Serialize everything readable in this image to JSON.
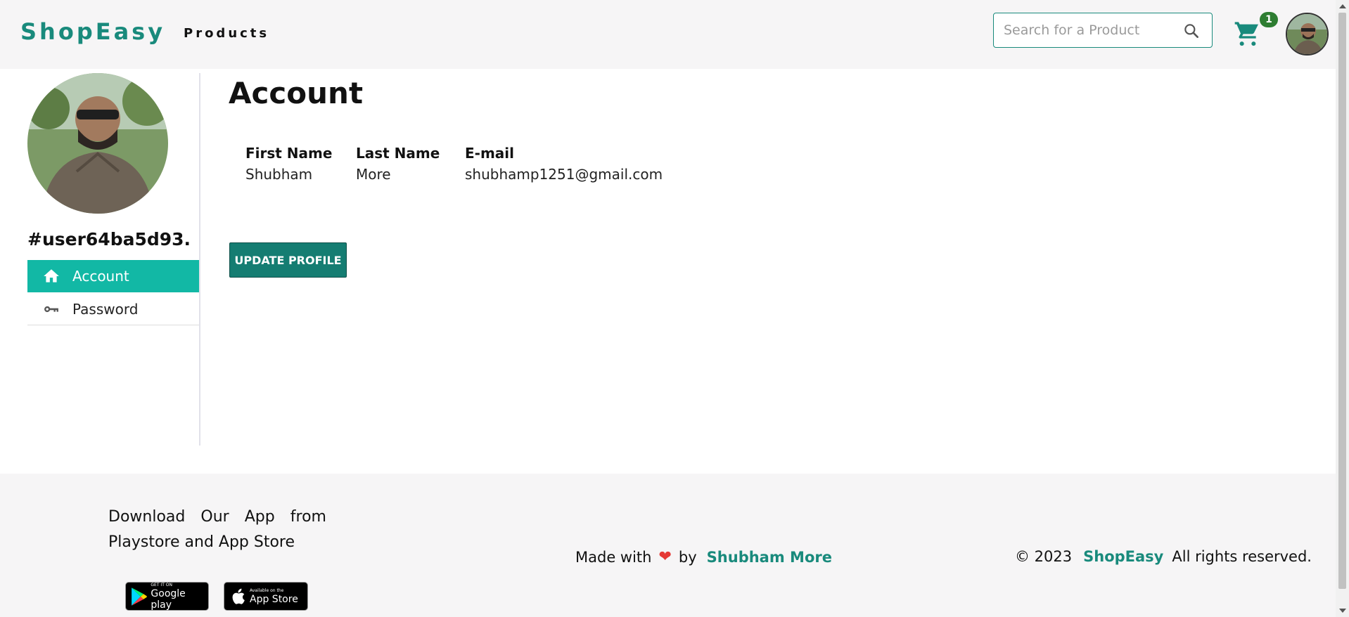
{
  "header": {
    "brand": "ShopEasy",
    "nav_products": "Products",
    "search_placeholder": "Search for a Product",
    "cart_count": "1"
  },
  "sidebar": {
    "username": "#user64ba5d93...",
    "items": [
      {
        "label": "Account",
        "icon": "home-icon",
        "active": true
      },
      {
        "label": "Password",
        "icon": "key-icon",
        "active": false
      }
    ]
  },
  "main": {
    "title": "Account",
    "fields": [
      {
        "label": "First Name",
        "value": "Shubham"
      },
      {
        "label": "Last Name",
        "value": "More"
      },
      {
        "label": "E-mail",
        "value": "shubhamp1251@gmail.com"
      }
    ],
    "update_button": "UPDATE PROFILE"
  },
  "footer": {
    "download_text": "Download Our App from Playstore and App Store",
    "google_play": {
      "small": "GET IT ON",
      "big": "Google play"
    },
    "app_store": {
      "small": "Available on the",
      "big": "App Store"
    },
    "made_with": "Made with",
    "by": "by",
    "author": "Shubham More",
    "copyright_year": "© 2023",
    "copyright_brand": "ShopEasy",
    "rights": "All rights reserved."
  },
  "colors": {
    "accent": "#198a7c",
    "active_menu": "#12b8a5",
    "button": "#157d72",
    "badge": "#2e7d32"
  }
}
